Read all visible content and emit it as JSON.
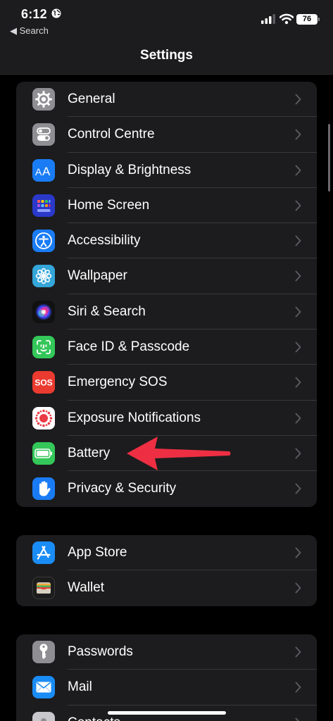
{
  "status": {
    "time": "6:12",
    "back_label": "◀ Search",
    "battery_level": "76"
  },
  "nav": {
    "title": "Settings"
  },
  "groups": [
    {
      "items": [
        {
          "label": "General",
          "icon": "gear-icon",
          "color": "#8e8e93"
        },
        {
          "label": "Control Centre",
          "icon": "toggles-icon",
          "color": "#8e8e93"
        },
        {
          "label": "Display & Brightness",
          "icon": "text-size-icon",
          "color": "#1a7cf5"
        },
        {
          "label": "Home Screen",
          "icon": "app-grid-icon",
          "color": "#2a39c9"
        },
        {
          "label": "Accessibility",
          "icon": "accessibility-icon",
          "color": "#1a7cf5"
        },
        {
          "label": "Wallpaper",
          "icon": "flower-icon",
          "color": "#33a6da"
        },
        {
          "label": "Siri & Search",
          "icon": "siri-icon",
          "color": "#1a1a2e"
        },
        {
          "label": "Face ID & Passcode",
          "icon": "face-id-icon",
          "color": "#34c759"
        },
        {
          "label": "Emergency SOS",
          "icon": "sos-icon",
          "color": "#eb3b30"
        },
        {
          "label": "Exposure Notifications",
          "icon": "exposure-icon",
          "color": "#ffffff"
        },
        {
          "label": "Battery",
          "icon": "battery-icon",
          "color": "#34c759"
        },
        {
          "label": "Privacy & Security",
          "icon": "hand-icon",
          "color": "#1a7cf5"
        }
      ]
    },
    {
      "items": [
        {
          "label": "App Store",
          "icon": "app-store-icon",
          "color": "#1a8cf5"
        },
        {
          "label": "Wallet",
          "icon": "wallet-icon",
          "color": "#1c1c1c"
        }
      ]
    },
    {
      "items": [
        {
          "label": "Passwords",
          "icon": "key-icon",
          "color": "#8e8e93"
        },
        {
          "label": "Mail",
          "icon": "mail-icon",
          "color": "#1a8cf5"
        },
        {
          "label": "Contacts",
          "icon": "contacts-icon",
          "color": "#c7c7cc"
        }
      ]
    }
  ],
  "annotation": {
    "color": "#ee2f43",
    "target": "Battery"
  }
}
